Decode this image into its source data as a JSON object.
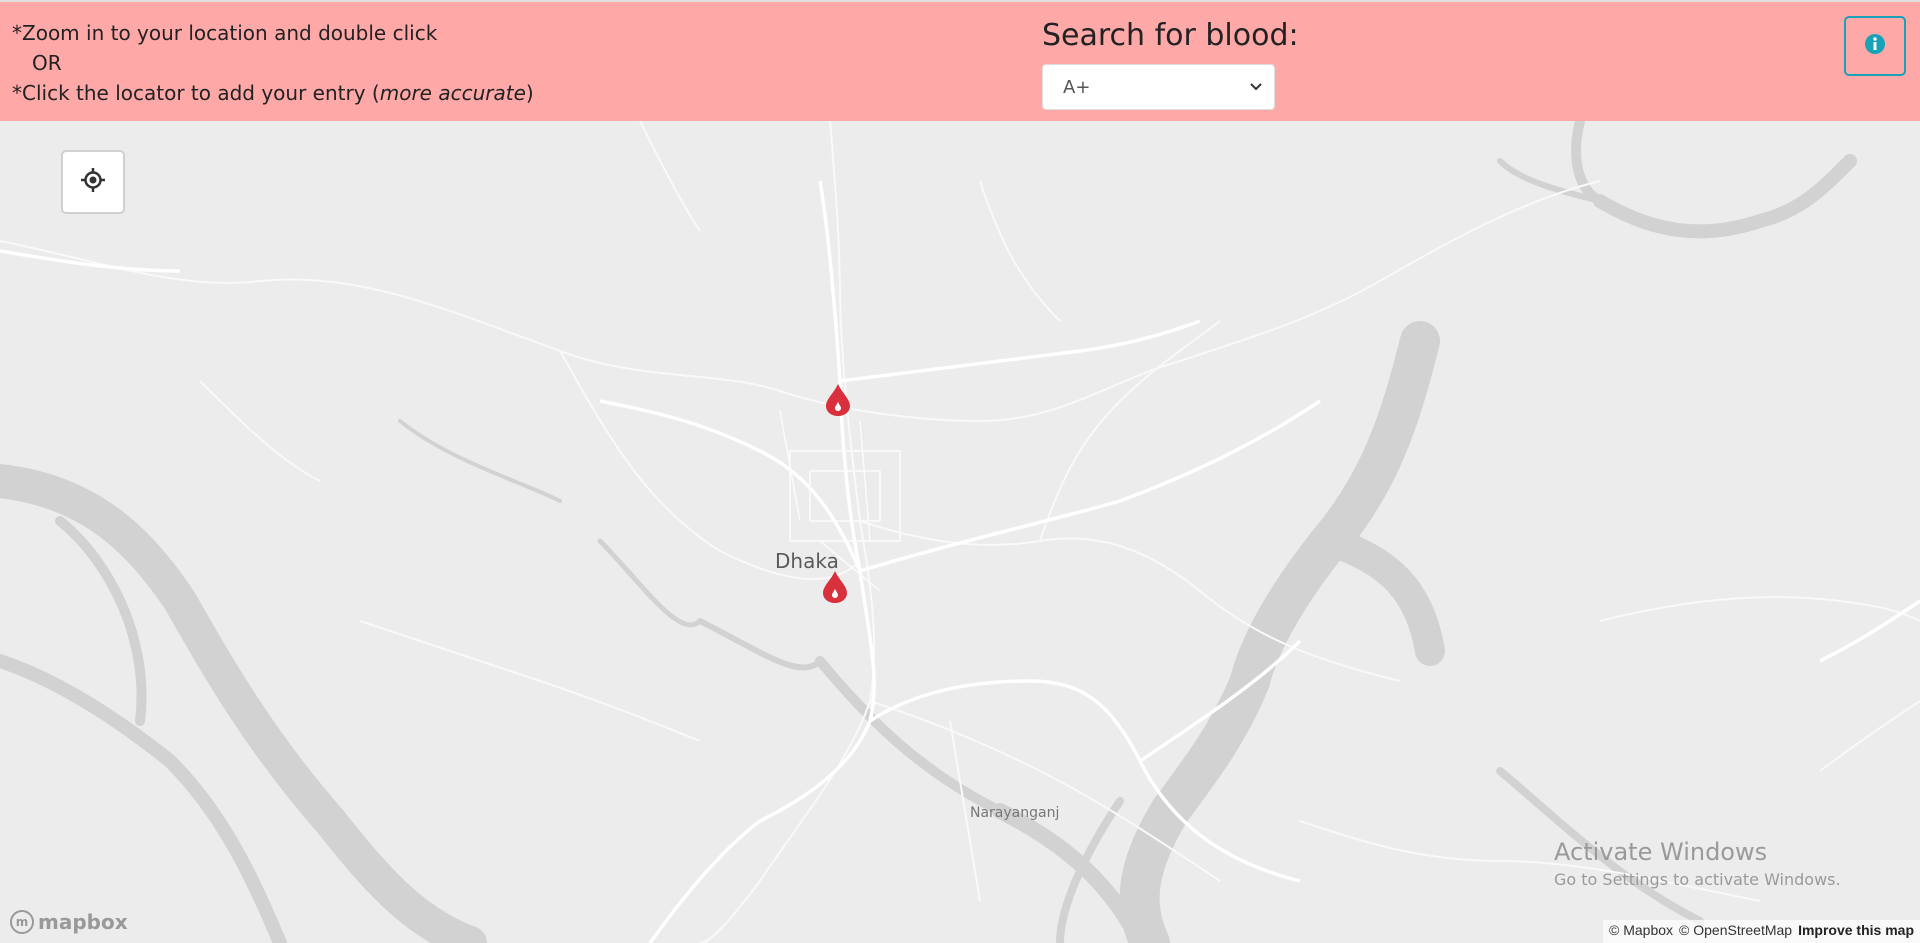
{
  "header": {
    "instruction_line1": "*Zoom in to your location and double click",
    "instruction_or": "OR",
    "instruction_line3_prefix": "*Click the locator to add your entry (",
    "instruction_line3_em": "more accurate",
    "instruction_line3_suffix": ")",
    "search_title": "Search for blood:",
    "blood_type_selected": "A+",
    "info_icon": "info-circle-icon",
    "accent_color": "#17a2b8",
    "bar_color": "#ffa8a8"
  },
  "map": {
    "locate_icon": "crosshair-icon",
    "labels": {
      "dhaka": "Dhaka",
      "narayanganj": "Narayanganj"
    },
    "pin_icon": "blood-drop-icon",
    "pin_color": "#d9303e"
  },
  "overlay": {
    "watermark_title": "Activate Windows",
    "watermark_sub": "Go to Settings to activate Windows."
  },
  "footer": {
    "logo_text": "mapbox",
    "attribution_mapbox": "© Mapbox",
    "attribution_osm": "© OpenStreetMap",
    "improve_link": "Improve this map"
  }
}
